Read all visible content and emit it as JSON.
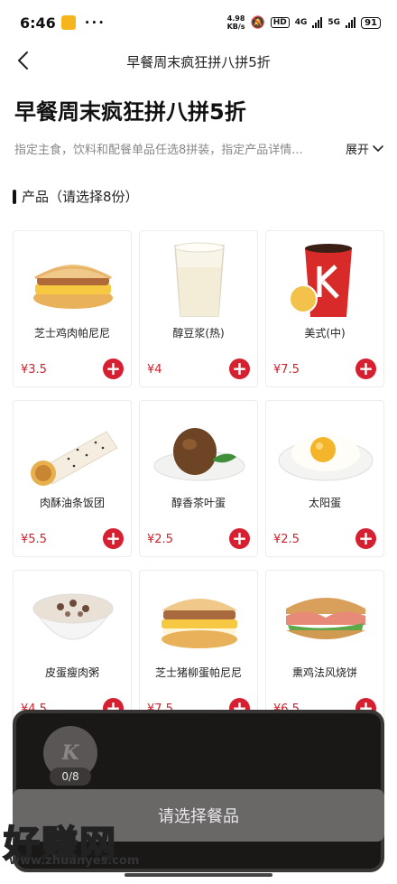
{
  "status": {
    "time": "6:46",
    "net_speed_value": "4.98",
    "net_speed_unit": "KB/s",
    "hd": "HD",
    "net1": "4G",
    "net2": "5G",
    "battery": "91"
  },
  "nav": {
    "title": "早餐周末疯狂拼八拼5折"
  },
  "header": {
    "title": "早餐周末疯狂拼八拼5折",
    "description": "指定主食，饮料和配餐单品任选8拼装，指定产品详情...",
    "expand_label": "展开"
  },
  "section": {
    "title": "产品（请选择8份）"
  },
  "products": [
    {
      "name": "芝士鸡肉帕尼尼",
      "price": "¥3.5",
      "icon": "panini-icon"
    },
    {
      "name": "醇豆浆(热)",
      "price": "¥4",
      "icon": "soy-milk-icon"
    },
    {
      "name": "美式(中)",
      "price": "¥7.5",
      "icon": "coffee-cup-icon"
    },
    {
      "name": "肉酥油条饭团",
      "price": "¥5.5",
      "icon": "rice-roll-icon"
    },
    {
      "name": "醇香茶叶蛋",
      "price": "¥2.5",
      "icon": "tea-egg-icon"
    },
    {
      "name": "太阳蛋",
      "price": "¥2.5",
      "icon": "fried-egg-icon"
    },
    {
      "name": "皮蛋瘦肉粥",
      "price": "¥4.5",
      "icon": "porridge-icon"
    },
    {
      "name": "芝士猪柳蛋帕尼尼",
      "price": "¥7.5",
      "icon": "pork-panini-icon"
    },
    {
      "name": "熏鸡法风烧饼",
      "price": "¥6.5",
      "icon": "chicken-flatbread-icon"
    }
  ],
  "cart": {
    "count": "0/8",
    "logo_letter": "K"
  },
  "action": {
    "select_label": "请选择餐品"
  },
  "watermark": {
    "text": "好赚网",
    "url": "www.zhuanyes.com"
  },
  "colors": {
    "accent": "#d62031",
    "price": "#d0202e",
    "cart_bg": "#1a1717"
  }
}
